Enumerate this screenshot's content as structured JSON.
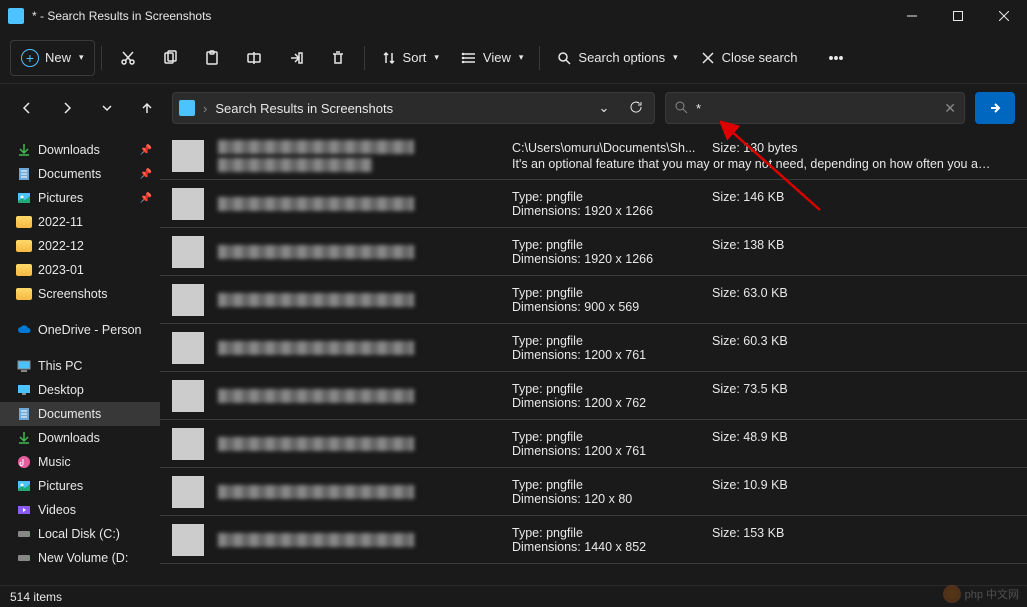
{
  "window": {
    "title": "* - Search Results in Screenshots"
  },
  "toolbar": {
    "new": "New",
    "sort": "Sort",
    "view": "View",
    "search_options": "Search options",
    "close_search": "Close search"
  },
  "address": {
    "location": "Search Results in Screenshots"
  },
  "search": {
    "query": "*"
  },
  "sidebar": {
    "items": [
      {
        "label": "Downloads",
        "kind": "dl",
        "pinned": true
      },
      {
        "label": "Documents",
        "kind": "doc",
        "pinned": true
      },
      {
        "label": "Pictures",
        "kind": "pic",
        "pinned": true
      },
      {
        "label": "2022-11",
        "kind": "folder"
      },
      {
        "label": "2022-12",
        "kind": "folder"
      },
      {
        "label": "2023-01",
        "kind": "folder"
      },
      {
        "label": "Screenshots",
        "kind": "folder"
      },
      {
        "label": "OneDrive - Person",
        "kind": "cloud"
      },
      {
        "label": "This PC",
        "kind": "pc"
      },
      {
        "label": "Desktop",
        "kind": "desk"
      },
      {
        "label": "Documents",
        "kind": "doc",
        "active": true
      },
      {
        "label": "Downloads",
        "kind": "dl"
      },
      {
        "label": "Music",
        "kind": "mus"
      },
      {
        "label": "Pictures",
        "kind": "pic"
      },
      {
        "label": "Videos",
        "kind": "vid"
      },
      {
        "label": "Local Disk (C:)",
        "kind": "disk"
      },
      {
        "label": "New Volume (D:",
        "kind": "disk"
      }
    ]
  },
  "labels": {
    "type": "Type:",
    "dimensions": "Dimensions:",
    "size": "Size:"
  },
  "results": [
    {
      "path": "C:\\Users\\omuru\\Documents\\Sh...",
      "size": "130 bytes",
      "desc": "It's an optional feature that you may or may not need, depending on how often you are e..."
    },
    {
      "type": "pngfile",
      "dimensions": "1920 x 1266",
      "size": "146 KB"
    },
    {
      "type": "pngfile",
      "dimensions": "1920 x 1266",
      "size": "138 KB"
    },
    {
      "type": "pngfile",
      "dimensions": "900 x 569",
      "size": "63.0 KB"
    },
    {
      "type": "pngfile",
      "dimensions": "1200 x 761",
      "size": "60.3 KB"
    },
    {
      "type": "pngfile",
      "dimensions": "1200 x 762",
      "size": "73.5 KB"
    },
    {
      "type": "pngfile",
      "dimensions": "1200 x 761",
      "size": "48.9 KB"
    },
    {
      "type": "pngfile",
      "dimensions": "120 x 80",
      "size": "10.9 KB"
    },
    {
      "type": "pngfile",
      "dimensions": "1440 x 852",
      "size": "153 KB"
    }
  ],
  "status": {
    "count": "514 items"
  },
  "watermark": "php 中文网"
}
